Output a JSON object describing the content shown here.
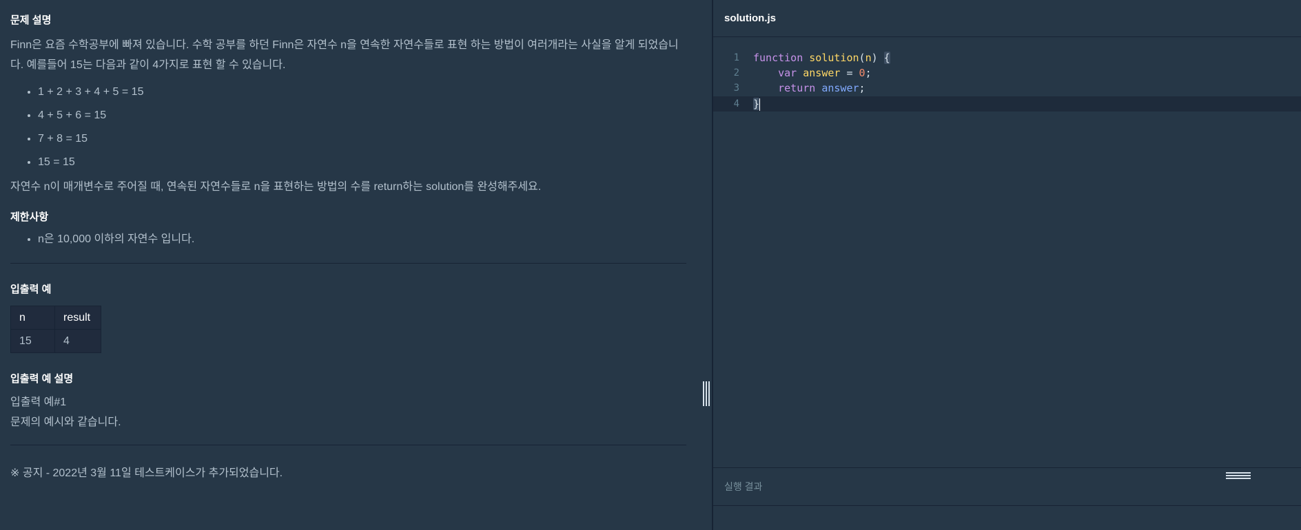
{
  "problem": {
    "heading": "문제 설명",
    "description": "Finn은 요즘 수학공부에 빠져 있습니다. 수학 공부를 하던 Finn은 자연수 n을 연속한 자연수들로 표현 하는 방법이 여러개라는 사실을 알게 되었습니다. 예를들어 15는 다음과 같이 4가지로 표현 할 수 있습니다.",
    "examples": [
      "1 + 2 + 3 + 4 + 5 = 15",
      "4 + 5 + 6 = 15",
      "7 + 8 = 15",
      "15 = 15"
    ],
    "task": "자연수 n이 매개변수로 주어질 때, 연속된 자연수들로 n을 표현하는 방법의 수를 return하는 solution를 완성해주세요."
  },
  "constraints": {
    "heading": "제한사항",
    "items": [
      "n은 10,000 이하의 자연수 입니다."
    ]
  },
  "io_example": {
    "heading": "입출력 예",
    "columns": [
      "n",
      "result"
    ],
    "rows": [
      [
        "15",
        "4"
      ]
    ]
  },
  "io_explanation": {
    "heading": "입출력 예 설명",
    "line1": "입출력 예#1",
    "line2": "문제의 예시와 같습니다."
  },
  "notice": "※ 공지 - 2022년 3월 11일 테스트케이스가 추가되었습니다.",
  "editor": {
    "filename": "solution.js",
    "line_numbers": [
      "1",
      "2",
      "3",
      "4"
    ],
    "code": {
      "l1_kw": "function",
      "l1_fn": "solution",
      "l1_param": "n",
      "l2_kw": "var",
      "l2_var": "answer",
      "l2_val": "0",
      "l3_kw": "return",
      "l3_id": "answer"
    }
  },
  "output": {
    "label": "실행 결과"
  }
}
